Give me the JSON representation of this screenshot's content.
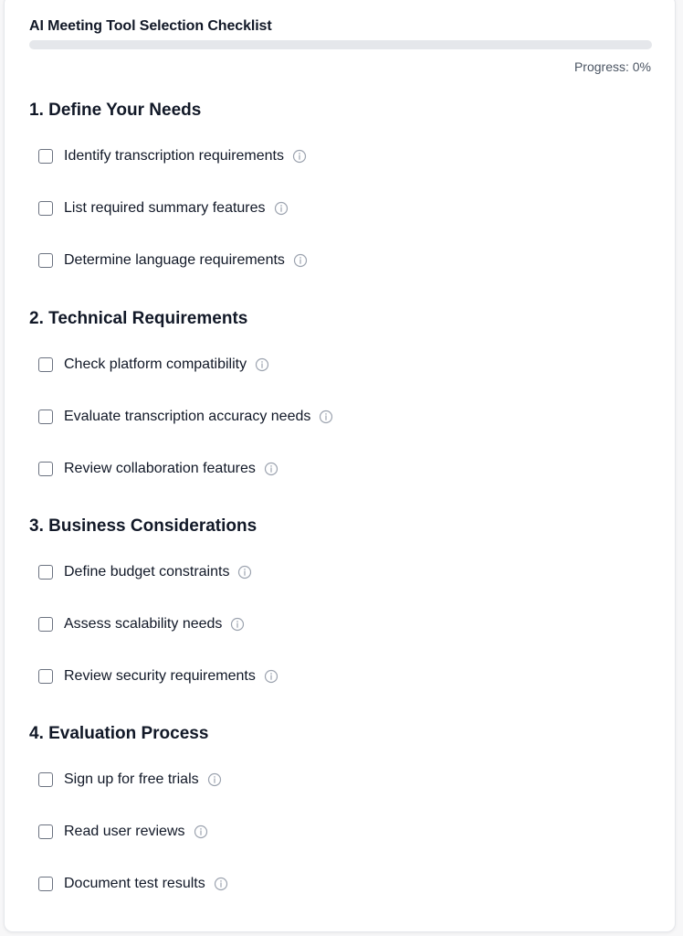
{
  "checklist": {
    "title": "AI Meeting Tool Selection Checklist",
    "progress_text": "Progress: 0%",
    "progress_value": 0,
    "accent_color": "#3b82f6",
    "sections": [
      {
        "heading": "1. Define Your Needs",
        "items": [
          {
            "label": "Identify transcription requirements",
            "checked": false
          },
          {
            "label": "List required summary features",
            "checked": false
          },
          {
            "label": "Determine language requirements",
            "checked": false
          }
        ]
      },
      {
        "heading": "2. Technical Requirements",
        "items": [
          {
            "label": "Check platform compatibility",
            "checked": false
          },
          {
            "label": "Evaluate transcription accuracy needs",
            "checked": false
          },
          {
            "label": "Review collaboration features",
            "checked": false
          }
        ]
      },
      {
        "heading": "3. Business Considerations",
        "items": [
          {
            "label": "Define budget constraints",
            "checked": false
          },
          {
            "label": "Assess scalability needs",
            "checked": false
          },
          {
            "label": "Review security requirements",
            "checked": false
          }
        ]
      },
      {
        "heading": "4. Evaluation Process",
        "items": [
          {
            "label": "Sign up for free trials",
            "checked": false
          },
          {
            "label": "Read user reviews",
            "checked": false
          },
          {
            "label": "Document test results",
            "checked": false
          }
        ]
      }
    ],
    "info_icon": "info-circle-icon"
  }
}
